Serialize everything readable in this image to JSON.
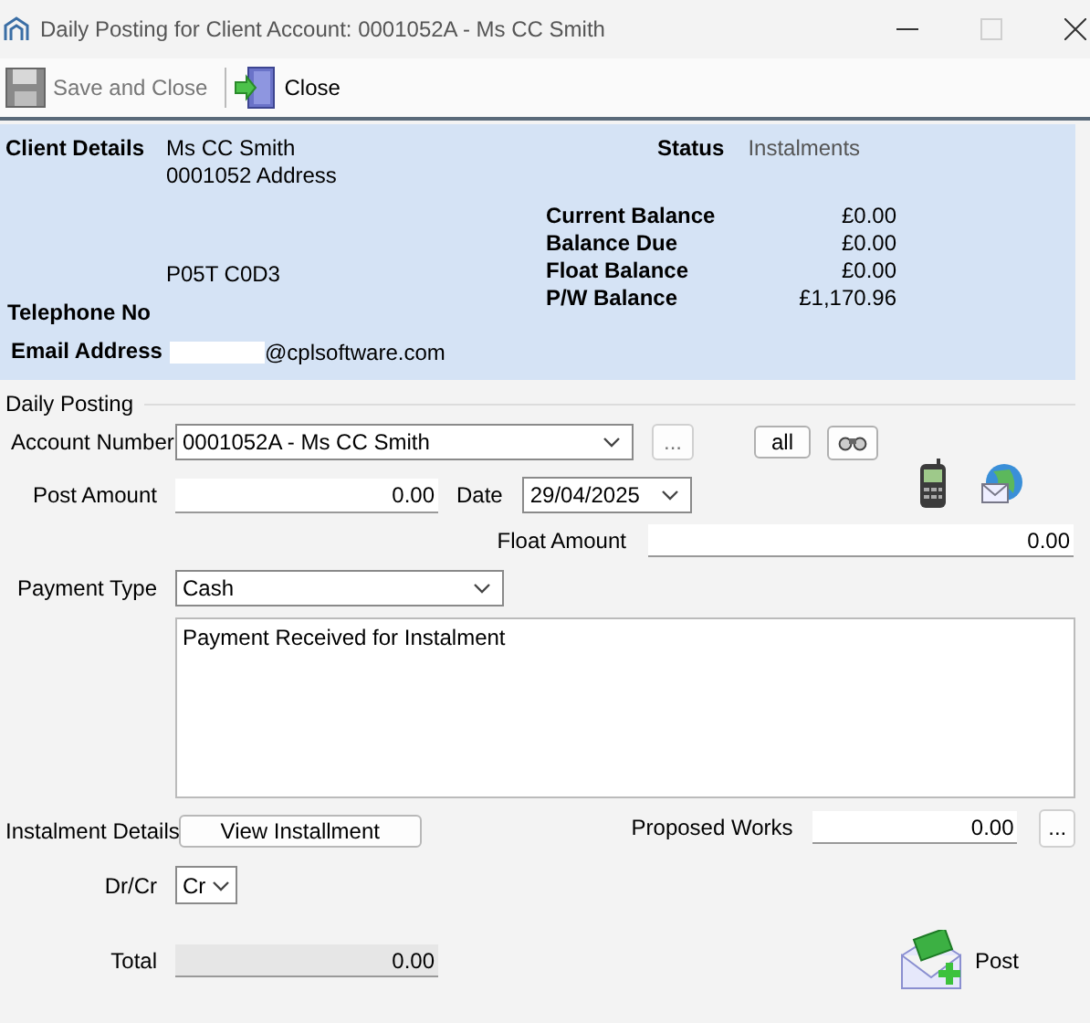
{
  "window": {
    "title": "Daily Posting for Client Account: 0001052A - Ms CC Smith",
    "maximize_disabled": true
  },
  "toolbar": [
    {
      "kind": "save",
      "label": "Save and Close",
      "disabled": true
    },
    {
      "kind": "close",
      "label": "Close",
      "disabled": false
    }
  ],
  "client": {
    "details_label": "Client Details",
    "address_lines": [
      "Ms CC Smith",
      "0001052 Address"
    ],
    "postcode": "P05T C0D3",
    "status_label": "Status",
    "status": "Instalments",
    "balances": [
      {
        "label": "Current Balance",
        "value": "£0.00"
      },
      {
        "label": "Balance Due",
        "value": "£0.00"
      },
      {
        "label": "Float Balance",
        "value": "£0.00"
      },
      {
        "label": "P/W Balance",
        "value": "£1,170.96"
      }
    ],
    "telephone_label": "Telephone No",
    "email_label": "Email Address",
    "email": "@cplsoftware.com"
  },
  "posting": {
    "group_label": "Daily Posting",
    "account_label": "Account Number",
    "account": "0001052A - Ms CC Smith",
    "browse_button": "...",
    "all_button": "all",
    "post_amount_label": "Post Amount",
    "post_amount": "0.00",
    "date_label": "Date",
    "date": "29/04/2025",
    "float_amount_label": "Float Amount",
    "float_amount": "0.00",
    "payment_type_label": "Payment Type",
    "payment_type": "Cash",
    "notes": "Payment Received for Instalment",
    "instalment_label": "Instalment Details",
    "view_button": "View Installment",
    "proposed_label": "Proposed Works",
    "proposed": "0.00",
    "proposed_button": "...",
    "drcr_label": "Dr/Cr",
    "drcr": "Cr",
    "total_label": "Total",
    "total": "0.00",
    "post_button": "Post"
  }
}
